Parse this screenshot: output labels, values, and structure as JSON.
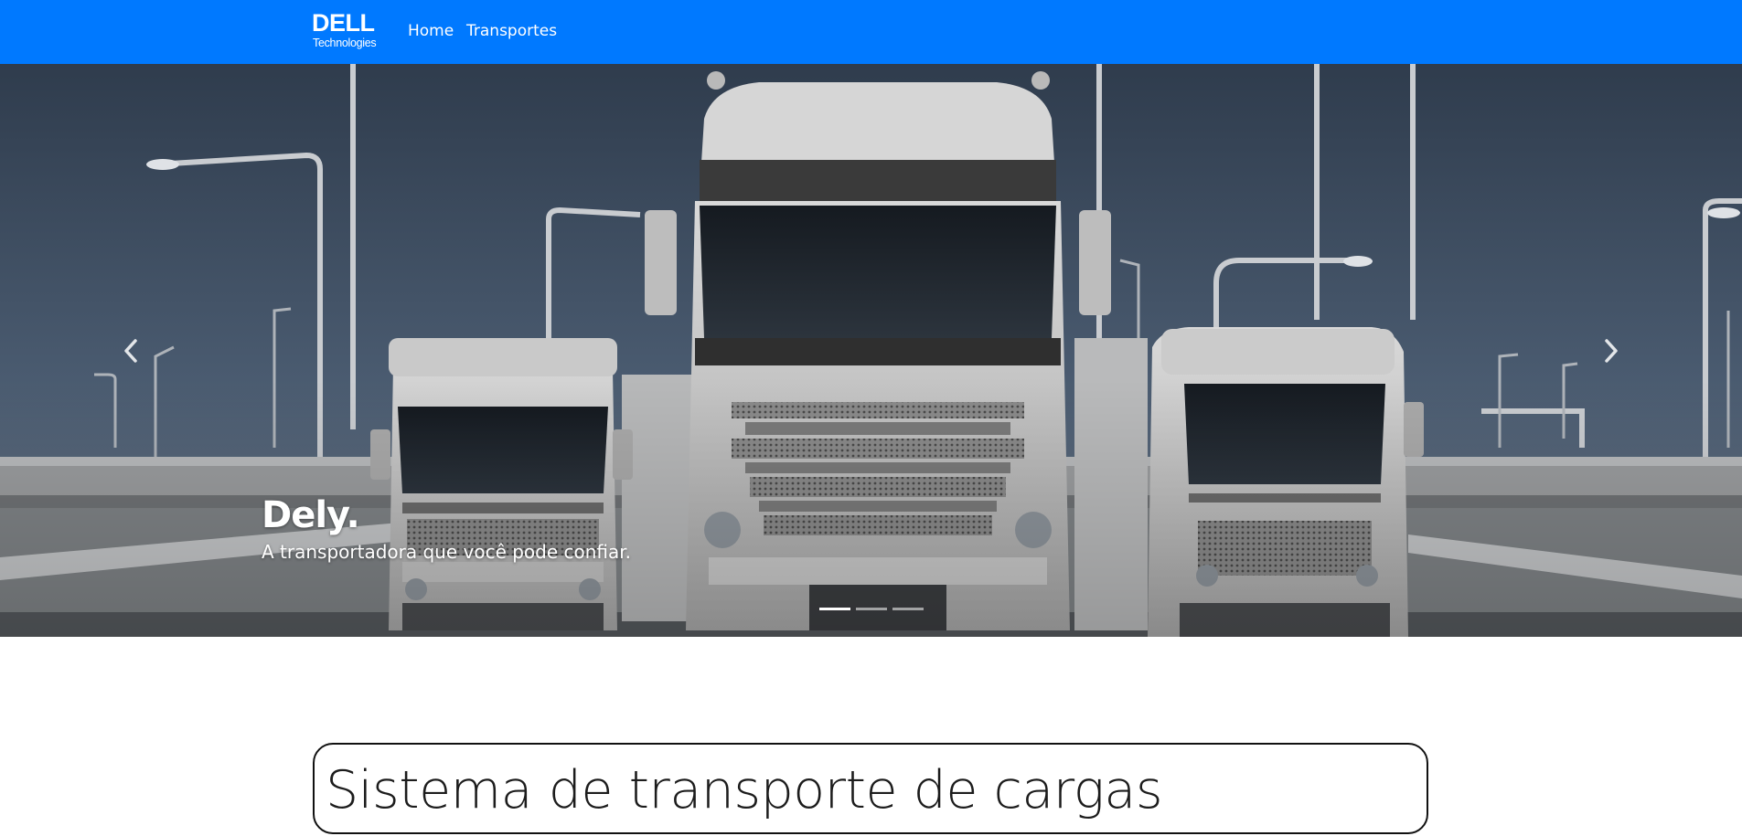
{
  "navbar": {
    "brand": {
      "wordmark": "DELL",
      "subtitle": "Technologies"
    },
    "links": [
      {
        "label": "Home"
      },
      {
        "label": "Transportes"
      }
    ]
  },
  "carousel": {
    "slide": {
      "title": "Dely.",
      "text": "A transportadora que você pode confiar."
    },
    "indicators": {
      "count": 3,
      "active": 1
    },
    "controls": {
      "prev": "chevron-left-icon",
      "next": "chevron-right-icon"
    }
  },
  "main": {
    "title": "Sistema de transporte de cargas"
  },
  "colors": {
    "navbar": "#0079ff",
    "text": "#1c1c1c",
    "caption": "#ffffff"
  }
}
